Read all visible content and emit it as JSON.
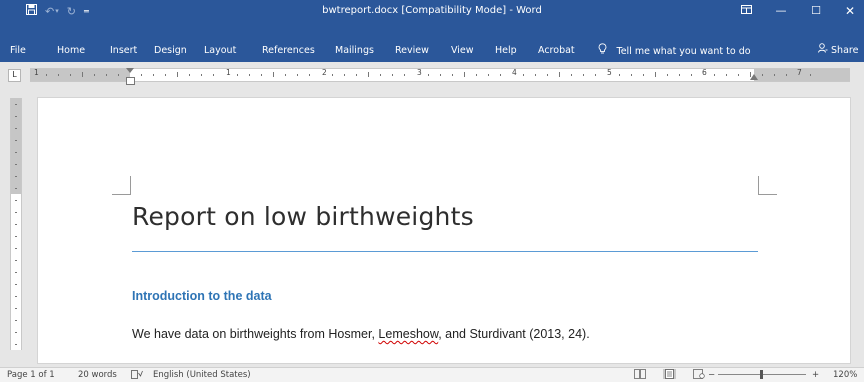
{
  "titlebar": {
    "title": "bwtreport.docx [Compatibility Mode]  -  Word",
    "qat": {
      "save_icon": "save-icon",
      "undo_icon": "undo-icon",
      "redo_icon": "redo-icon",
      "customize_icon": "customize-qat-icon"
    },
    "window_buttons": [
      "ribbon-display-options",
      "minimize",
      "restore",
      "close"
    ]
  },
  "ribbon": {
    "tabs": [
      "File",
      "Home",
      "Insert",
      "Design",
      "Layout",
      "References",
      "Mailings",
      "Review",
      "View",
      "Help",
      "Acrobat"
    ],
    "tell_me": "Tell me what you want to do",
    "share": "Share",
    "bg_color": "#2b579a"
  },
  "ruler": {
    "tab_selector": "L",
    "numbers": [
      "1",
      "1",
      "2",
      "3",
      "4",
      "5",
      "6",
      "7"
    ]
  },
  "document": {
    "title": "Report on low birthweights",
    "heading1": "Introduction to the data",
    "para_before": "We have data on birthweights from Hosmer, ",
    "para_flagged": "Lemeshow",
    "para_after": ", and Sturdivant (2013, 24).",
    "title_rule_color": "#5b9bd5",
    "heading_color": "#2e74b5"
  },
  "statusbar": {
    "page": "Page 1 of 1",
    "words": "20 words",
    "language": "English (United States)",
    "zoom": "120%",
    "zoom_minus": "−",
    "zoom_plus": "+",
    "zoom_value": 120
  }
}
